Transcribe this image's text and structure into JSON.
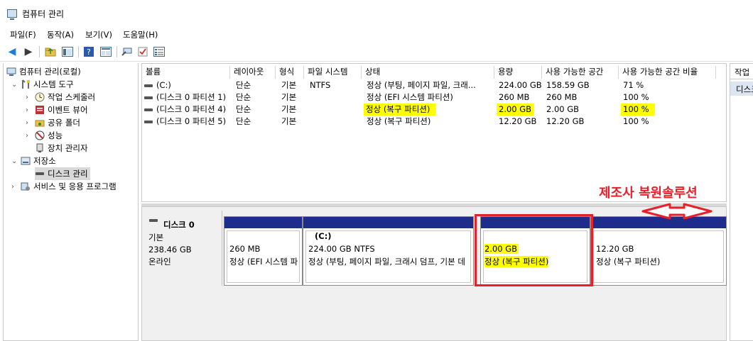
{
  "window": {
    "title": "컴퓨터 관리"
  },
  "menu": [
    "파일(F)",
    "동작(A)",
    "보기(V)",
    "도움말(H)"
  ],
  "toolbar": {
    "icons": [
      "back-icon",
      "forward-icon",
      "up-folder-icon",
      "show-hide-tree-icon",
      "help-icon",
      "properties-icon",
      "connect-icon",
      "checklist-icon",
      "export-icon"
    ],
    "colors": {
      "back": "#1e7ed6",
      "forward": "#3c3c3c"
    }
  },
  "tree": {
    "root": "컴퓨터 관리(로컬)",
    "system_tools": "시스템 도구",
    "task_scheduler": "작업 스케줄러",
    "event_viewer": "이벤트 뷰어",
    "shared_folders": "공유 폴더",
    "performance": "성능",
    "device_manager": "장치 관리자",
    "storage": "저장소",
    "disk_management": "디스크 관리",
    "services_apps": "서비스 및 응용 프로그램"
  },
  "volumes": {
    "headers": [
      "볼륨",
      "레이아웃",
      "형식",
      "파일 시스템",
      "상태",
      "용량",
      "사용 가능한 공간",
      "사용 가능한 공간 비율"
    ],
    "rows": [
      {
        "volume": "(C:)",
        "layout": "단순",
        "type": "기본",
        "fs": "NTFS",
        "status": "정상 (부팅, 페이지 파일, 크래...",
        "capacity": "224.00 GB",
        "free": "158.59 GB",
        "pct": "71 %",
        "highlight": false
      },
      {
        "volume": "(디스크 0 파티션 1)",
        "layout": "단순",
        "type": "기본",
        "fs": "",
        "status": "정상 (EFI 시스템 파티션)",
        "capacity": "260 MB",
        "free": "260 MB",
        "pct": "100 %",
        "highlight": false
      },
      {
        "volume": "(디스크 0 파티션 4)",
        "layout": "단순",
        "type": "기본",
        "fs": "",
        "status": "정상 (복구 파티션)",
        "capacity": "2.00 GB",
        "free": "2.00 GB",
        "pct": "100 %",
        "highlight": true
      },
      {
        "volume": "(디스크 0 파티션 5)",
        "layout": "단순",
        "type": "기본",
        "fs": "",
        "status": "정상 (복구 파티션)",
        "capacity": "12.20 GB",
        "free": "12.20 GB",
        "pct": "100 %",
        "highlight": false
      }
    ]
  },
  "disk": {
    "name": "디스크 0",
    "type": "기본",
    "size": "238.46 GB",
    "state": "온라인",
    "partitions": [
      {
        "label": "",
        "size": "260 MB",
        "status": "정상 (EFI 시스템 파"
      },
      {
        "label": "(C:)",
        "size": "224.00 GB NTFS",
        "status": "정상 (부팅, 페이지 파일, 크래시 덤프, 기본 데"
      },
      {
        "label": "",
        "size": "2.00 GB",
        "status": "정상 (복구 파티션)"
      },
      {
        "label": "",
        "size": "12.20 GB",
        "status": "정상 (복구 파티션)"
      }
    ]
  },
  "annotation": {
    "label": "제조사 복원솔루션",
    "color": "#e8202a"
  },
  "actions": {
    "header": "작업",
    "item": "디스크 관리"
  }
}
